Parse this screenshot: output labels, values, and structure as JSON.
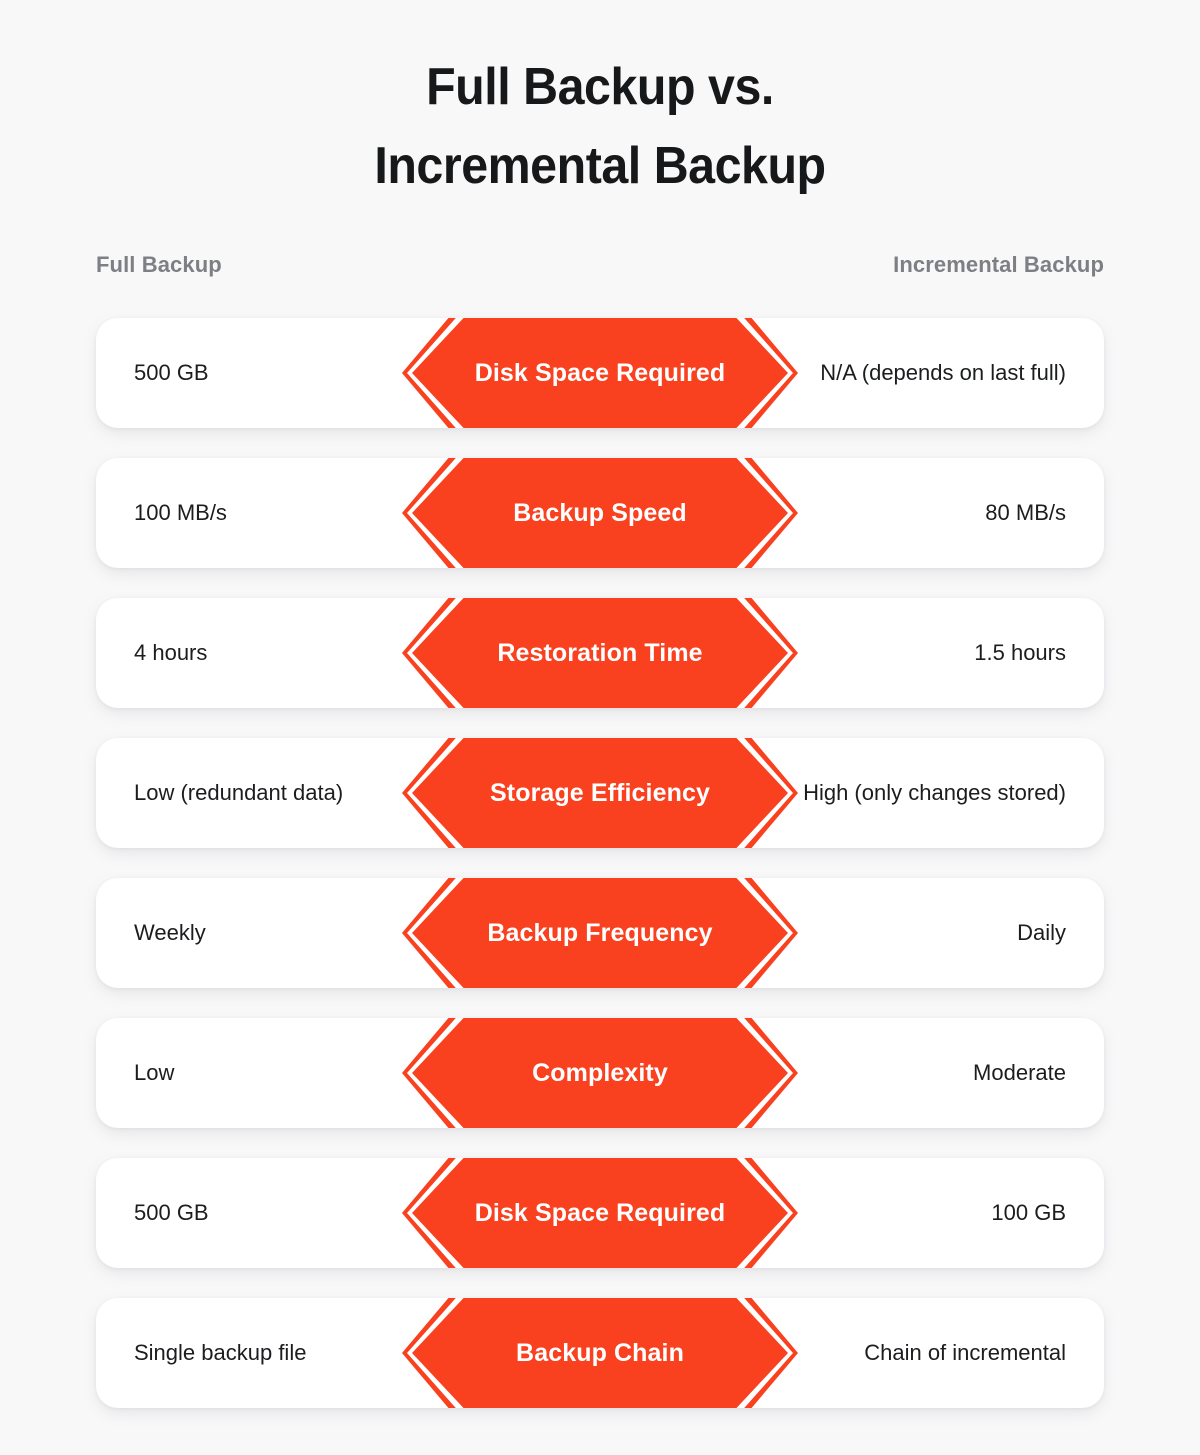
{
  "title": {
    "line1": "Full Backup vs.",
    "line2": "Incremental Backup"
  },
  "headers": {
    "left": "Full Backup",
    "right": "Incremental Backup"
  },
  "colors": {
    "accent": "#F9401F",
    "background": "#F8F8F9",
    "card": "#FFFFFF",
    "header_text": "#7D7F84",
    "body_text": "#1C1D1F",
    "title_text": "#17181A"
  },
  "rows": [
    {
      "attribute": "Disk Space Required",
      "full_backup": "500 GB",
      "incremental_backup": "N/A (depends on last full)"
    },
    {
      "attribute": "Backup Speed",
      "full_backup": "100 MB/s",
      "incremental_backup": "80 MB/s"
    },
    {
      "attribute": "Restoration Time",
      "full_backup": "4 hours",
      "incremental_backup": "1.5 hours"
    },
    {
      "attribute": "Storage Efficiency",
      "full_backup": "Low (redundant data)",
      "incremental_backup": "High (only changes stored)"
    },
    {
      "attribute": "Backup Frequency",
      "full_backup": "Weekly",
      "incremental_backup": "Daily"
    },
    {
      "attribute": "Complexity",
      "full_backup": "Low",
      "incremental_backup": "Moderate"
    },
    {
      "attribute": "Disk Space Required",
      "full_backup": "500 GB",
      "incremental_backup": "100 GB"
    },
    {
      "attribute": "Backup Chain",
      "full_backup": "Single backup file",
      "incremental_backup": "Chain of incremental"
    }
  ]
}
